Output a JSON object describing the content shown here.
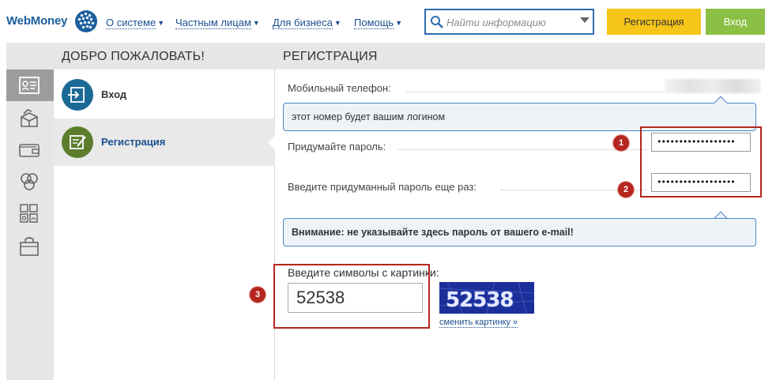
{
  "header": {
    "logo": "WebMoney",
    "nav": [
      {
        "label": "О системе"
      },
      {
        "label": "Частным лицам"
      },
      {
        "label": "Для бизнеса"
      },
      {
        "label": "Помощь"
      }
    ],
    "search": {
      "placeholder": "Найти информацию"
    },
    "register_button": "Регистрация",
    "login_button": "Вход"
  },
  "welcome": {
    "title": "ДОБРО ПОЖАЛОВАТЬ!",
    "items": [
      {
        "label": "Вход"
      },
      {
        "label": "Регистрация"
      }
    ]
  },
  "registration": {
    "title": "РЕГИСТРАЦИЯ",
    "phone_label": "Мобильный телефон:",
    "phone_hint": "этот номер будет вашим логином",
    "password_label": "Придумайте пароль:",
    "password_value": "••••••••••••••••••",
    "password_repeat_label": "Введите придуманный пароль еще раз:",
    "password_repeat_value": "••••••••••••••••••",
    "password_warning_bold": "Внимание: не указывайте здесь пароль от вашего e-mail!",
    "captcha_label": "Введите символы с картинки:",
    "captcha_value": "52538",
    "captcha_image_text": "52538",
    "captcha_change": "сменить картинку »"
  },
  "annotations": [
    "1",
    "2",
    "3"
  ],
  "colors": {
    "brand_blue": "#1b5e9e",
    "register_yellow": "#f5c518",
    "login_green": "#8cbf45",
    "annotation_red": "#b4261f",
    "login_circle": "#1b6a96",
    "register_circle": "#5c7d2c"
  }
}
